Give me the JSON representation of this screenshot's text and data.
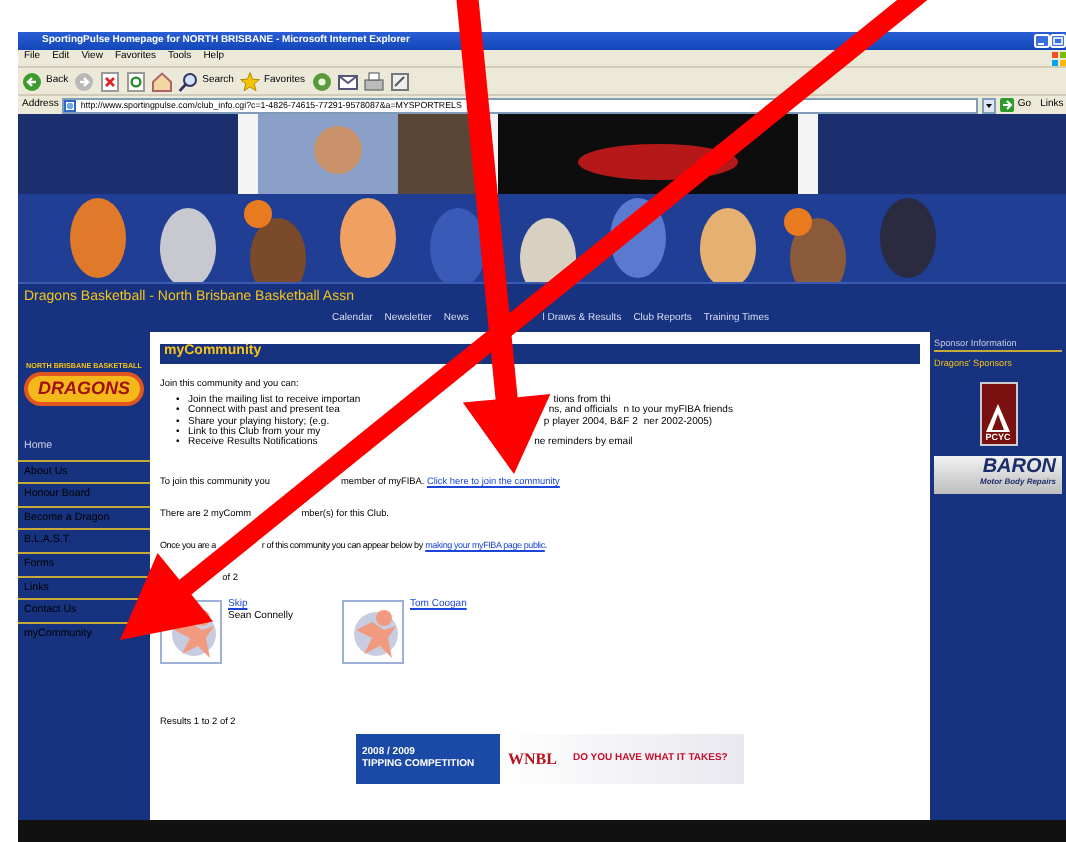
{
  "window": {
    "title": "SportingPulse Homepage for NORTH BRISBANE - Microsoft Internet Explorer"
  },
  "menu": [
    "File",
    "Edit",
    "View",
    "Favorites",
    "Tools",
    "Help"
  ],
  "toolbar": [
    {
      "kind": "back",
      "label": "Back"
    },
    {
      "kind": "forward"
    },
    {
      "kind": "stop"
    },
    {
      "kind": "refresh"
    },
    {
      "kind": "home"
    },
    {
      "kind": "search",
      "label": "Search"
    },
    {
      "kind": "favorites",
      "label": "Favorites"
    },
    {
      "kind": "media"
    },
    {
      "kind": "mail"
    },
    {
      "kind": "print"
    },
    {
      "kind": "edit"
    }
  ],
  "address": {
    "label": "Address",
    "value": "http://www.sportingpulse.com/club_info.cgi?c=1-4826-74615-77291-9578087&a=MYSPORTRELS",
    "go": "Go",
    "links": "Links"
  },
  "site": {
    "title": "Dragons Basketball - North Brisbane Basketball Assn",
    "nav": [
      "Calendar",
      "Newsletter",
      "News",
      "l Draws & Results",
      "Club Reports",
      "Training Times"
    ],
    "logo": {
      "top": "NORTH BRISBANE BASKETBALL",
      "name": "DRAGONS"
    },
    "sidebar": [
      "Home",
      "About Us",
      "Honour Board",
      "Become a Dragon",
      "B.L.A.S.T.",
      "Forms",
      "Links",
      "Contact Us",
      "myCommunity"
    ]
  },
  "content": {
    "heading": "myCommunity",
    "intro": "Join this community and you can:",
    "bullet": "•",
    "bullets": [
      [
        "Join the mailing list to receive importan",
        "tions from thi"
      ],
      [
        "Connect with past and present tea",
        "ns, and officials",
        "n to your myFIBA friends"
      ],
      [
        "Share your playing history; (e.g.",
        "p player 2004, B&F 2",
        "ner 2002-2005)"
      ],
      [
        "Link to this Club from your my"
      ],
      [
        "Receive Results Notifications",
        "ne reminders by email"
      ]
    ],
    "join": {
      "parts": [
        "To join this community you",
        "member of myFIBA."
      ],
      "link": "Click here to join the community"
    },
    "count": [
      "There are 2 myComm",
      "mber(s) for this Club."
    ],
    "appear": {
      "parts": [
        "Once you are a",
        "r of this community you can appear below by"
      ],
      "link": "making your myFIBA page public",
      "end": "."
    },
    "results_top": "of 2",
    "members": [
      {
        "name": "Skip",
        "subtitle": "Sean Connelly"
      },
      {
        "name": "Tom Coogan"
      }
    ],
    "results": "Results 1 to 2 of 2",
    "ad": {
      "season": "2008 / 2009",
      "title": "TIPPING COMPETITION",
      "brand": "WNBL",
      "slogan": "DO YOU HAVE WHAT IT TAKES?"
    }
  },
  "sponsors": {
    "info": "Sponsor Information",
    "heading": "Dragons' Sponsors",
    "items": [
      {
        "kind": "pcyc",
        "name": "PCYC"
      },
      {
        "kind": "baron",
        "name": "BARON",
        "tagline": "Motor Body Repairs"
      }
    ]
  }
}
